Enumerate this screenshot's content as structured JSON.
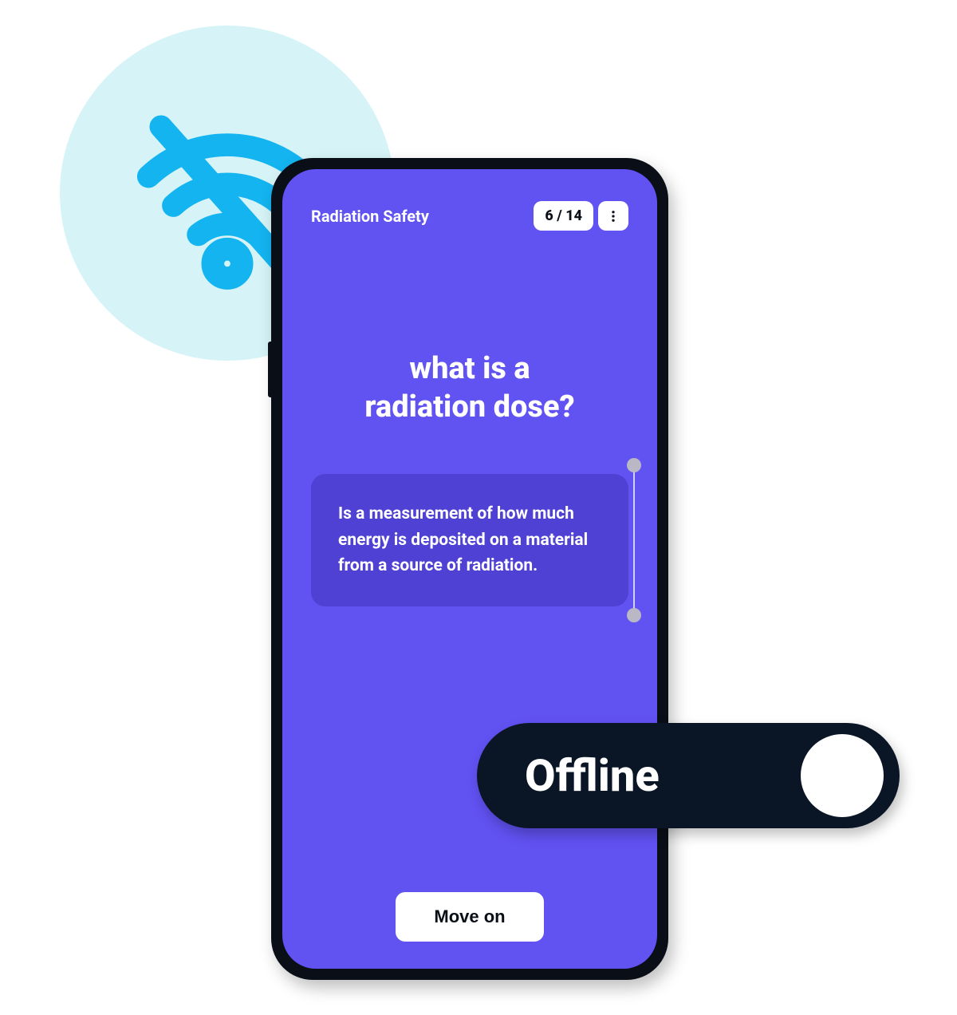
{
  "badge": {
    "icon_name": "wifi-off-icon",
    "circle_color": "#d6f4f7",
    "icon_color": "#14b4f0"
  },
  "app": {
    "title": "Radiation Safety",
    "progress": "6 / 14",
    "question": "what is a\nradiation dose?",
    "answer": "Is a measurement of how much energy is deposited on a material from a source of radiation.",
    "cta": "Move on",
    "colors": {
      "screen": "#6152f2",
      "card": "#4f41d3"
    }
  },
  "toggle": {
    "label": "Offline",
    "state": "off",
    "pill_color": "#0a1626"
  }
}
